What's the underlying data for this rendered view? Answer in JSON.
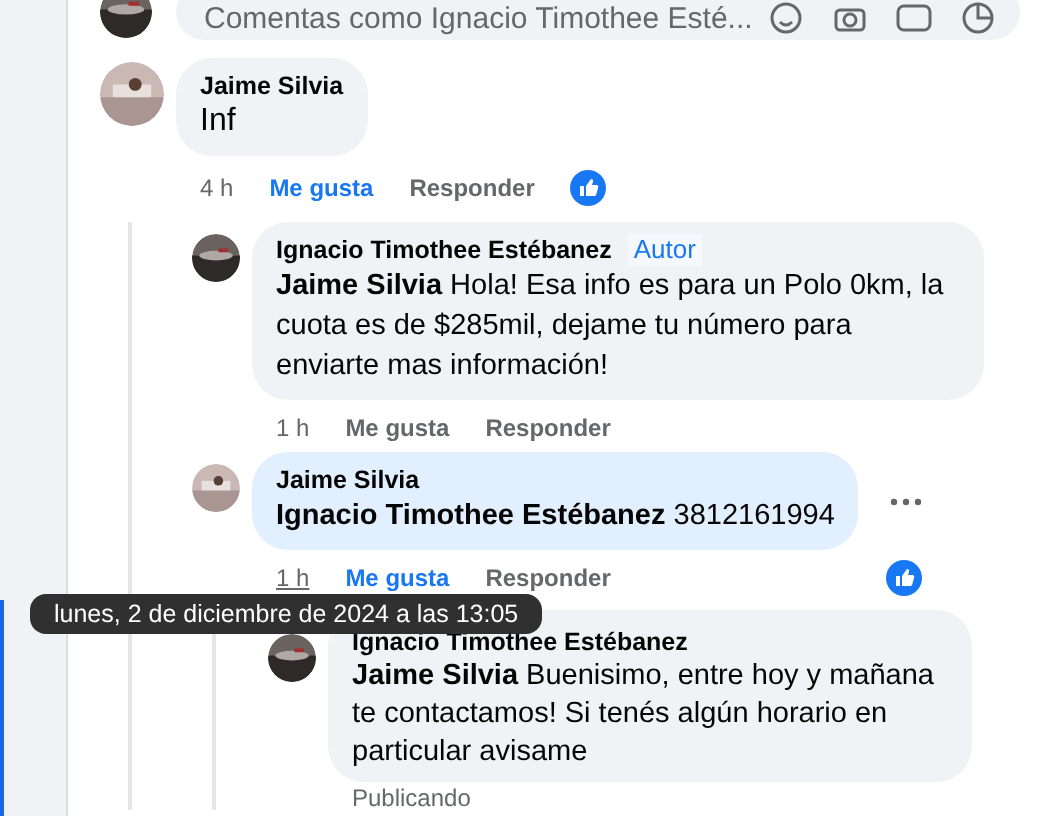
{
  "composer": {
    "placeholder": "Comentas como Ignacio Timothee Esté..."
  },
  "comments": [
    {
      "author": "Jaime Silvia",
      "text": "Inf",
      "time": "4 h",
      "time_hovered": false,
      "like": "Me gusta",
      "liked": true,
      "reply": "Responder",
      "reaction": true,
      "children": [
        {
          "author": "Ignacio Timothee Estébanez",
          "badge": "Autor",
          "text": "**Jaime Silvia** Hola! Esa info es para un Polo 0km, la cuota es de $285mil, dejame tu número para enviarte mas información!",
          "time": "1 h",
          "time_hovered": false,
          "like": "Me gusta",
          "liked": false,
          "reply": "Responder"
        },
        {
          "author": "Jaime Silvia",
          "text": "**Ignacio Timothee Estébanez** 3812161994",
          "time": "1 h",
          "time_hovered": true,
          "like": "Me gusta",
          "liked": true,
          "reply": "Responder",
          "reaction": true,
          "highlighted": true,
          "menu": true,
          "children": [
            {
              "author": "Ignacio Timothee Estébanez",
              "text": "**Jaime Silvia** Buenisimo, entre hoy y mañana te contactamos! Si tenés algún horario en particular avisame",
              "status": "Publicando"
            }
          ]
        }
      ]
    }
  ],
  "tooltip": {
    "text": "lunes, 2 de diciembre de 2024 a las 13:05"
  }
}
